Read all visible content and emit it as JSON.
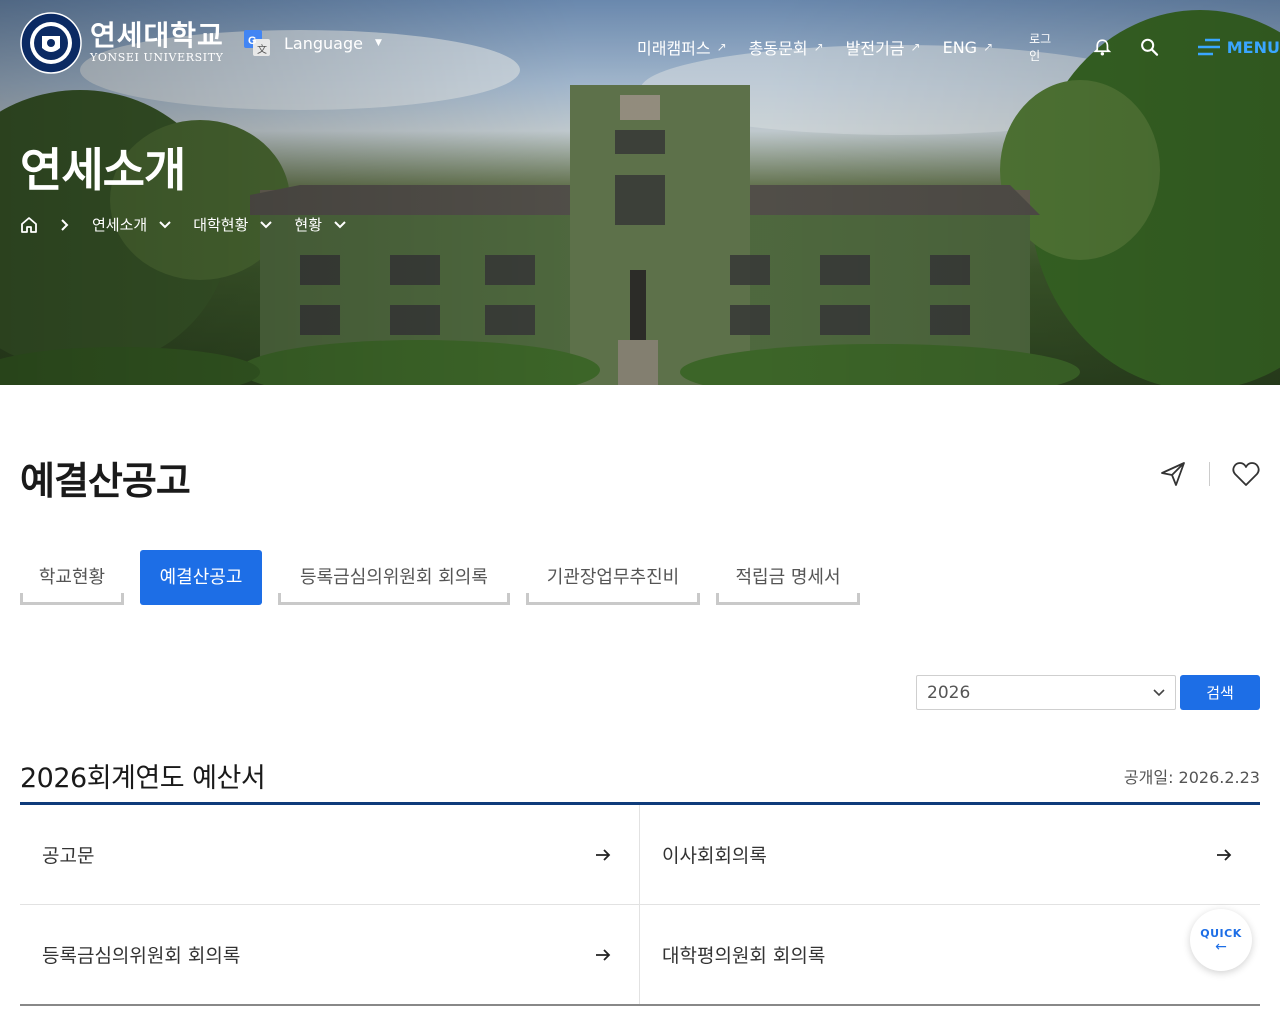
{
  "brand": {
    "name_ko": "연세대학교",
    "name_en": "YONSEI UNIVERSITY"
  },
  "language": {
    "label": "Language"
  },
  "gnb": {
    "links": [
      {
        "label": "미래캠퍼스"
      },
      {
        "label": "총동문회"
      },
      {
        "label": "발전기금"
      },
      {
        "label": "ENG"
      }
    ],
    "login": "로그인",
    "menu": "MENU"
  },
  "page": {
    "heading": "연세소개"
  },
  "breadcrumb": [
    {
      "label": "연세소개"
    },
    {
      "label": "대학현황"
    },
    {
      "label": "현황"
    }
  ],
  "section": {
    "title": "예결산공고"
  },
  "tabs": [
    {
      "label": "학교현황",
      "active": false
    },
    {
      "label": "예결산공고",
      "active": true
    },
    {
      "label": "등록금심의위원회 회의록",
      "active": false
    },
    {
      "label": "기관장업무추진비",
      "active": false
    },
    {
      "label": "적립금 명세서",
      "active": false
    }
  ],
  "filter": {
    "selected_year": "2026",
    "search_label": "검색"
  },
  "document": {
    "title": "2026회계연도 예산서",
    "published": "공개일: 2026.2.23",
    "items": [
      {
        "label": "공고문"
      },
      {
        "label": "이사회회의록"
      },
      {
        "label": "등록금심의위원회 회의록"
      },
      {
        "label": "대학평의원회 회의록"
      }
    ]
  },
  "quick": {
    "label": "QUICK"
  },
  "colors": {
    "accent": "#1d6ee6",
    "navy_rule": "#0e3b7a",
    "menu_blue": "#3aa6ff"
  }
}
